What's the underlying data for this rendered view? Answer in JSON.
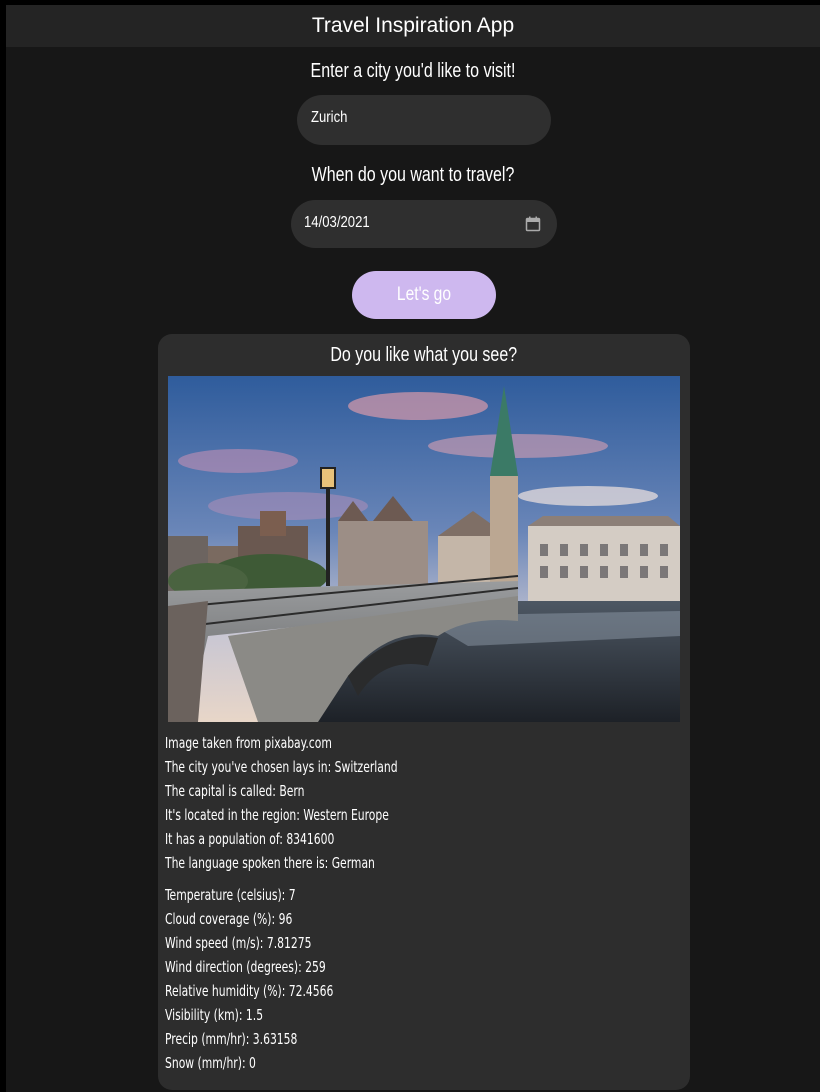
{
  "app": {
    "title": "Travel Inspiration App"
  },
  "form": {
    "city_label": "Enter a city you'd like to visit!",
    "city_value": "Zurich",
    "date_label": "When do you want to travel?",
    "date_value": "14/03/2021",
    "submit_label": "Let's go"
  },
  "result": {
    "title": "Do you like what you see?",
    "image_credit": "Image taken from pixabay.com",
    "country_info": [
      "The city you've chosen lays in: Switzerland",
      "The capital is called: Bern",
      "It's located in the region: Western Europe",
      "It has a population of: 8341600",
      "The language spoken there is: German"
    ],
    "weather": [
      "Temperature (celsius): 7",
      "Cloud coverage (%): 96",
      "Wind speed (m/s): 7.81275",
      "Wind direction (degrees): 259",
      "Relative humidity (%): 72.4566",
      "Visibility (km): 1.5",
      "Precip (mm/hr): 3.63158",
      "Snow (mm/hr): 0"
    ]
  },
  "colors": {
    "accent": "#ceb8ef",
    "card": "#2d2d2d",
    "background": "#171717",
    "header": "#242424"
  }
}
